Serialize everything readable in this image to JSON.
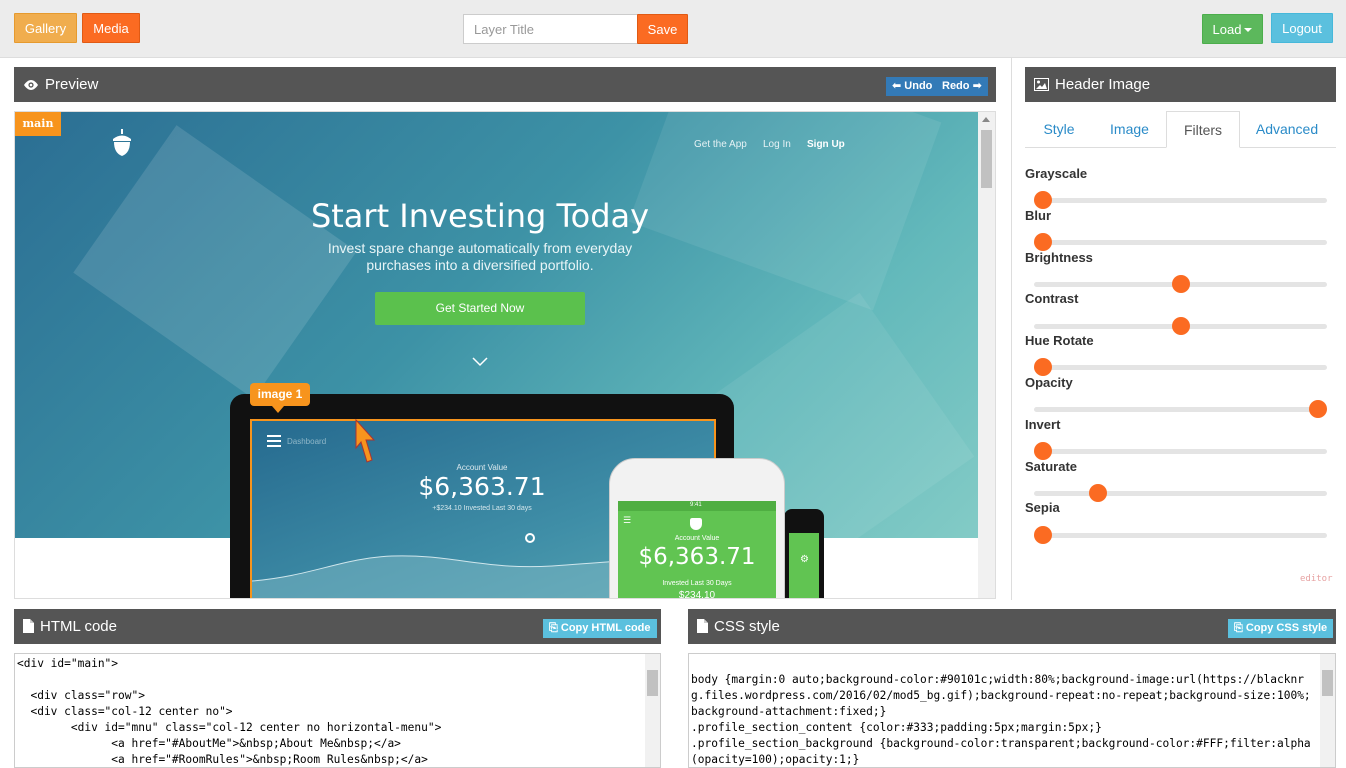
{
  "toolbar": {
    "gallery_label": "Gallery",
    "media_label": "Media",
    "layer_title_placeholder": "Layer Title",
    "layer_title_value": "",
    "save_label": "Save",
    "load_label": "Load",
    "logout_label": "Logout"
  },
  "preview": {
    "title": "Preview",
    "undo_label": "Undo",
    "redo_label": "Redo",
    "main_tag": "main",
    "image_tag": "image 1",
    "site": {
      "nav_links": [
        "Get the App",
        "Log In",
        "Sign Up"
      ],
      "headline": "Start Investing Today",
      "subline": "Invest spare change automatically from everyday purchases into a diversified portfolio.",
      "cta_label": "Get Started Now",
      "dashboard_label": "Dashboard",
      "account_label": "Account Value",
      "account_value": "$6,363.71",
      "invested_note": "+$234.10 Invested Last 30 days",
      "phone_account_label": "Account Value",
      "phone_account_value": "$6,363.71",
      "phone_invested_note": "Invested Last 30 Days",
      "phone_invested_value": "$234.10",
      "phone_time": "9:41"
    }
  },
  "right_panel": {
    "title": "Header Image",
    "tabs": [
      "Style",
      "Image",
      "Filters",
      "Advanced"
    ],
    "active_tab": "Filters",
    "filters": [
      {
        "label": "Grayscale",
        "value": 0.03
      },
      {
        "label": "Blur",
        "value": 0.03
      },
      {
        "label": "Brightness",
        "value": 0.5
      },
      {
        "label": "Contrast",
        "value": 0.5
      },
      {
        "label": "Hue Rotate",
        "value": 0.03
      },
      {
        "label": "Opacity",
        "value": 0.97
      },
      {
        "label": "Invert",
        "value": 0.03
      },
      {
        "label": "Saturate",
        "value": 0.22
      },
      {
        "label": "Sepia",
        "value": 0.03
      }
    ],
    "editor_mark": "editor"
  },
  "html_panel": {
    "title": "HTML code",
    "copy_label": "Copy HTML code",
    "lines": [
      "<div id=\"main\">",
      "",
      "  <div class=\"row\">",
      "  <div class=\"col-12 center no\">",
      "        <div id=\"mnu\" class=\"col-12 center no horizontal-menu\">",
      "              <a href=\"#AboutMe\">&nbsp;About Me&nbsp;</a>",
      "              <a href=\"#RoomRules\">&nbsp;Room Rules&nbsp;</a>"
    ]
  },
  "css_panel": {
    "title": "CSS style",
    "copy_label": "Copy CSS style",
    "lines": [
      "body {margin:0 auto;background-color:#90101c;width:80%;background-image:url(https://blacknrg.files.wordpress.com/2016/02/mod5_bg.gif);background-repeat:no-repeat;background-size:100%;background-attachment:fixed;}",
      ".profile_section_content {color:#333;padding:5px;margin:5px;}",
      ".profile_section_background {background-color:transparent;background-color:#FFF;filter:alpha(opacity=100);opacity:1;}"
    ]
  },
  "colors": {
    "orange": "#fb6b22",
    "amber": "#f0ad4e",
    "green": "#5cb85c",
    "info": "#5bc0de",
    "header_gray": "#555555",
    "tag_orange": "#f7941d"
  }
}
